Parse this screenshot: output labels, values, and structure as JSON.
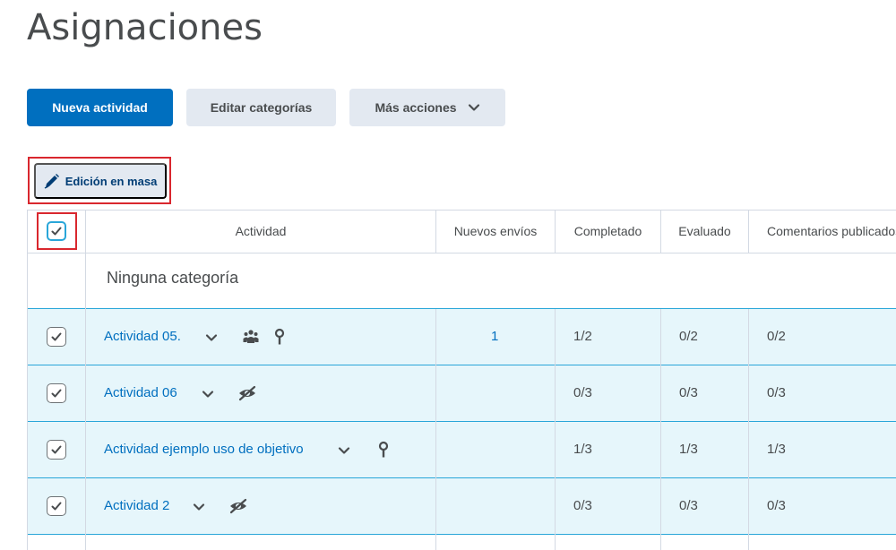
{
  "page": {
    "title": "Asignaciones"
  },
  "toolbar": {
    "new_activity": "Nueva actividad",
    "edit_categories": "Editar categorías",
    "more_actions": "Más acciones",
    "bulk_edit": "Edición en masa"
  },
  "table": {
    "headers": [
      "Actividad",
      "Nuevos envíos",
      "Completado",
      "Evaluado",
      "Comentarios publicados"
    ],
    "category": "Ninguna categoría",
    "rows": [
      {
        "name": "Actividad 05.",
        "icons": [
          "chevron-down-icon",
          "group-icon",
          "objective-pin-icon"
        ],
        "new_submissions": "1",
        "completed": "1/2",
        "evaluated": "0/2",
        "feedback": "0/2"
      },
      {
        "name": "Actividad 06",
        "icons": [
          "chevron-down-icon",
          "hidden-eye-icon"
        ],
        "new_submissions": "",
        "completed": "0/3",
        "evaluated": "0/3",
        "feedback": "0/3"
      },
      {
        "name": "Actividad ejemplo uso de objetivo",
        "icons": [
          "chevron-down-icon",
          "objective-pin-icon"
        ],
        "new_submissions": "",
        "completed": "1/3",
        "evaluated": "1/3",
        "feedback": "1/3"
      },
      {
        "name": "Actividad 2",
        "icons": [
          "chevron-down-icon",
          "hidden-eye-icon"
        ],
        "new_submissions": "",
        "completed": "0/3",
        "evaluated": "0/3",
        "feedback": "0/3"
      }
    ]
  },
  "colors": {
    "primary": "#006fbf",
    "selected_row": "#e6f6fb",
    "highlight": "#d9272e",
    "secondary_button": "#e3e9f1"
  }
}
